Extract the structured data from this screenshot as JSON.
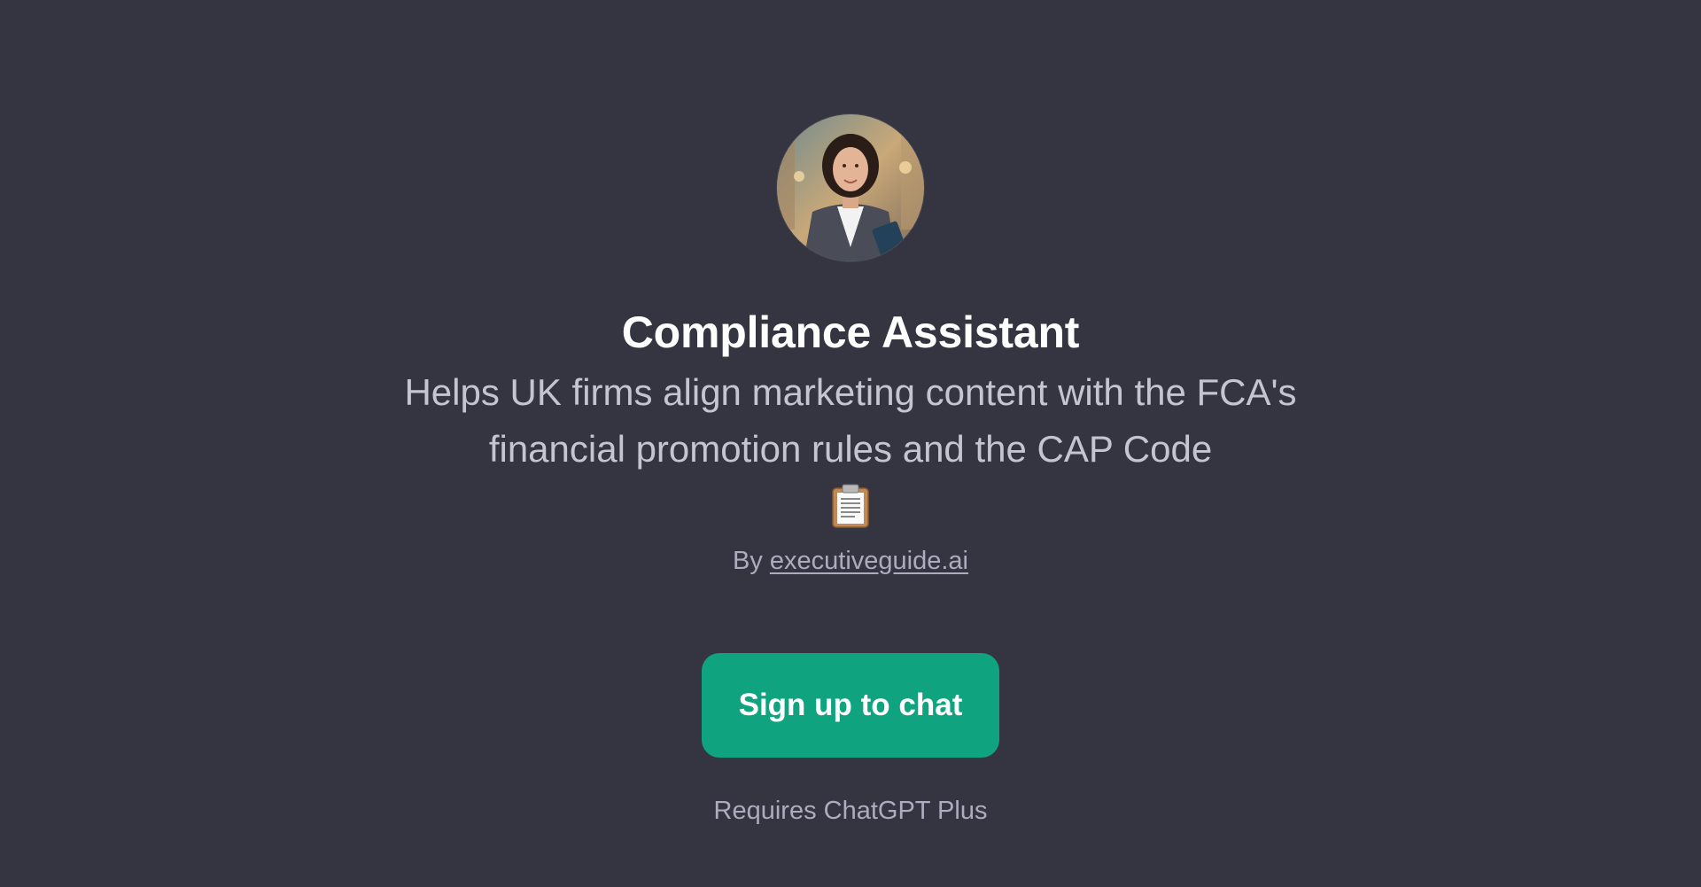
{
  "gpt": {
    "name": "Compliance Assistant",
    "description": "Helps UK firms align marketing content with the FCA's financial promotion rules and the CAP Code",
    "emoji_icon": "clipboard-icon",
    "author_prefix": "By",
    "author_link": "executiveguide.ai",
    "avatar_icon": "avatar-photo"
  },
  "cta": {
    "signup_label": "Sign up to chat",
    "requirement_note": "Requires ChatGPT Plus"
  },
  "colors": {
    "background": "#343541",
    "button": "#10a37f",
    "title": "#ffffff",
    "description": "#c5c5d2",
    "muted": "#acacbe"
  }
}
